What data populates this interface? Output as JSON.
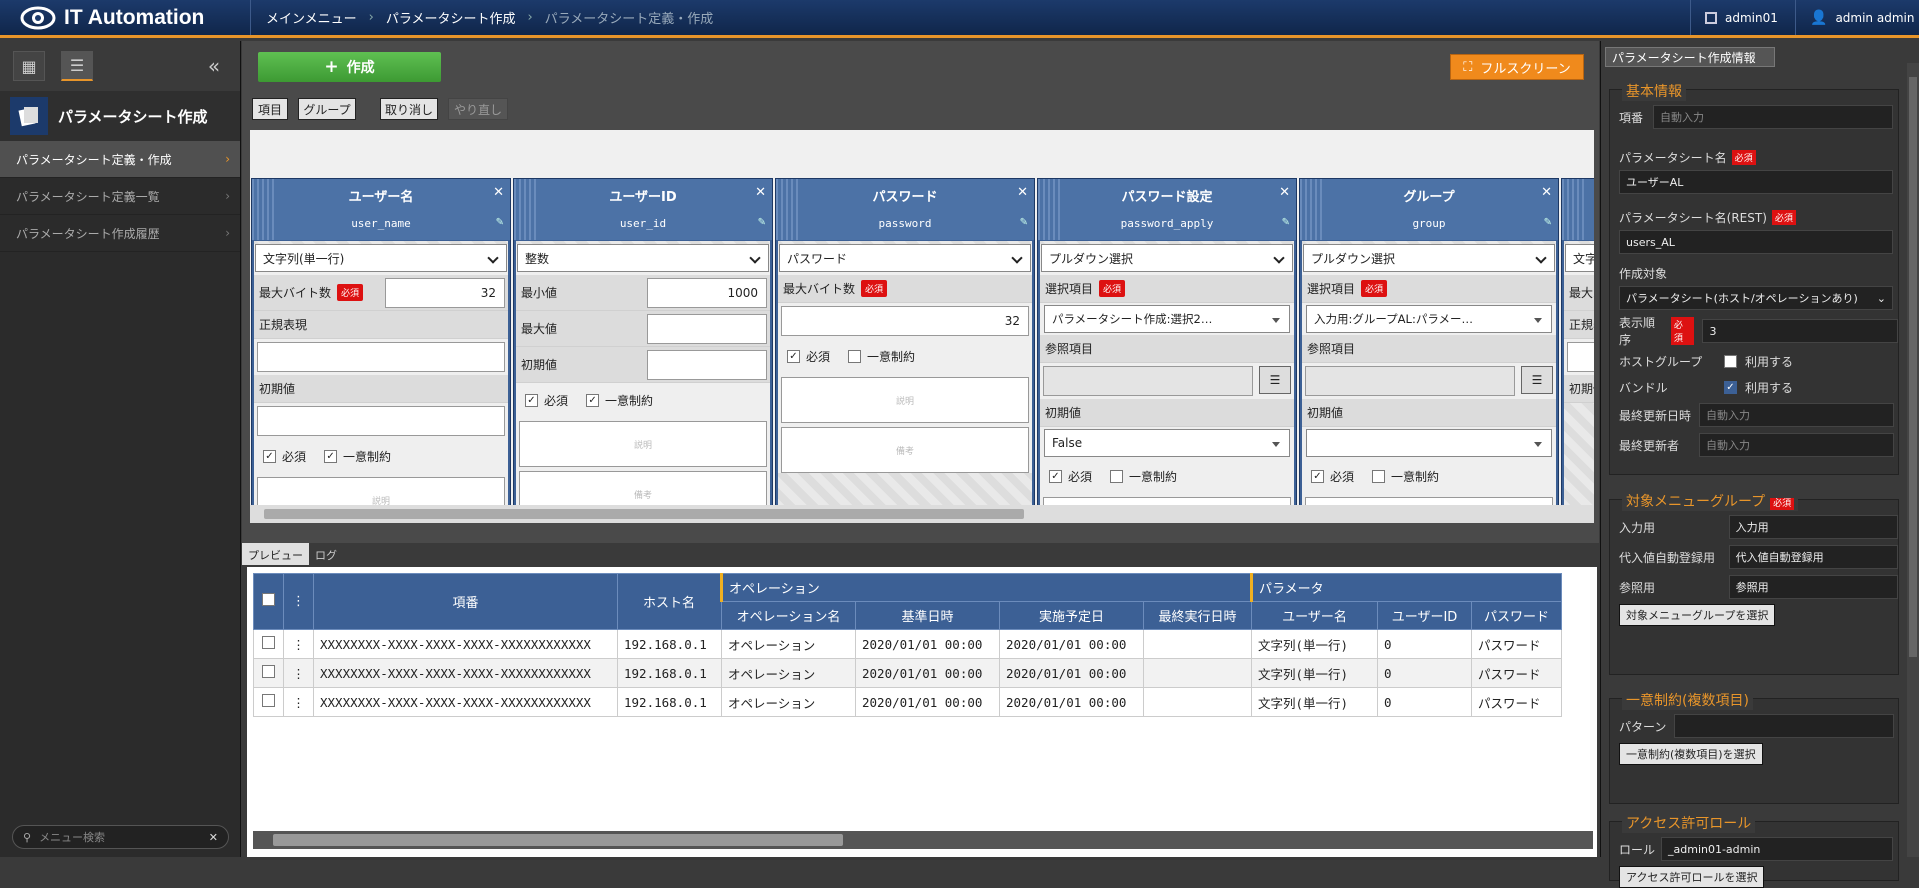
{
  "header": {
    "app_title": "IT Automation",
    "breadcrumbs": [
      "メインメニュー",
      "パラメータシート作成",
      "パラメータシート定義・作成"
    ],
    "workspace": "admin01",
    "user": "admin admin"
  },
  "sidebar": {
    "title": "パラメータシート作成",
    "items": [
      {
        "label": "パラメータシート定義・作成"
      },
      {
        "label": "パラメータシート定義一覧"
      },
      {
        "label": "パラメータシート作成履歴"
      }
    ],
    "search_placeholder": "メニュー検索"
  },
  "toolbar": {
    "create": "作成",
    "fullscreen": "フルスクリーン",
    "item": "項目",
    "group": "グループ",
    "undo": "取り消し",
    "redo": "やり直し"
  },
  "common": {
    "required": "必須",
    "unique": "一意制約",
    "desc": "説明",
    "note": "備考"
  },
  "columns": [
    {
      "name": "ユーザー名",
      "id": "user_name",
      "type": "文字列(単一行)",
      "maxbyte_label": "最大バイト数",
      "maxbyte": "32",
      "regex_label": "正規表現",
      "default_label": "初期値"
    },
    {
      "name": "ユーザーID",
      "id": "user_id",
      "type": "整数",
      "min_label": "最小値",
      "min": "1000",
      "max_label": "最大値",
      "default_label": "初期値"
    },
    {
      "name": "パスワード",
      "id": "password",
      "type": "パスワード",
      "maxbyte_label": "最大バイト数",
      "maxbyte": "32"
    },
    {
      "name": "パスワード設定",
      "id": "password_apply",
      "type": "プルダウン選択",
      "sel_label": "選択項目",
      "sel_value": "パラメータシート作成:選択2…",
      "ref_label": "参照項目",
      "default_label": "初期値",
      "default": "False"
    },
    {
      "name": "グループ",
      "id": "group",
      "type": "プルダウン選択",
      "sel_label": "選択項目",
      "sel_value": "入力用:グループAL:パラメー…",
      "ref_label": "参照項目",
      "default_label": "初期値",
      "default": ""
    }
  ],
  "partial_col": {
    "type": "文字",
    "maxbyte_label": "最大バ",
    "regex_label": "正規表",
    "default_label": "初期値"
  },
  "preview": {
    "tabs": [
      "プレビュー",
      "ログ"
    ],
    "headers": {
      "item_no": "項番",
      "host": "ホスト名",
      "op_group": "オペレーション",
      "op_name": "オペレーション名",
      "base_date": "基準日時",
      "plan_date": "実施予定日",
      "last_run": "最終実行日時",
      "param_group": "パラメータ",
      "user_name": "ユーザー名",
      "user_id": "ユーザーID",
      "password": "パスワード"
    },
    "rows": [
      {
        "item_no": "XXXXXXXX-XXXX-XXXX-XXXX-XXXXXXXXXXXX",
        "host": "192.168.0.1",
        "op_name": "オペレーション",
        "base_date": "2020/01/01 00:00",
        "plan_date": "2020/01/01 00:00",
        "last_run": "",
        "user_name": "文字列(単一行)",
        "user_id": "0",
        "password": "パスワード"
      },
      {
        "item_no": "XXXXXXXX-XXXX-XXXX-XXXX-XXXXXXXXXXXX",
        "host": "192.168.0.1",
        "op_name": "オペレーション",
        "base_date": "2020/01/01 00:00",
        "plan_date": "2020/01/01 00:00",
        "last_run": "",
        "user_name": "文字列(単一行)",
        "user_id": "0",
        "password": "パスワード"
      },
      {
        "item_no": "XXXXXXXX-XXXX-XXXX-XXXX-XXXXXXXXXXXX",
        "host": "192.168.0.1",
        "op_name": "オペレーション",
        "base_date": "2020/01/01 00:00",
        "plan_date": "2020/01/01 00:00",
        "last_run": "",
        "user_name": "文字列(単一行)",
        "user_id": "0",
        "password": "パスワード"
      }
    ]
  },
  "panel": {
    "tab": "パラメータシート作成情報",
    "basic": {
      "legend": "基本情報",
      "item_no_label": "項番",
      "item_no": "自動入力",
      "name_label": "パラメータシート名",
      "name": "ユーザーAL",
      "rest_label": "パラメータシート名(REST)",
      "rest": "users_AL",
      "target_label": "作成対象",
      "target": "パラメータシート(ホスト/オペレーションあり)",
      "order_label": "表示順序",
      "order": "3",
      "hostgroup_label": "ホストグループ",
      "bundle_label": "バンドル",
      "use": "利用する",
      "updated_label": "最終更新日時",
      "updated": "自動入力",
      "updater_label": "最終更新者",
      "updater": "自動入力"
    },
    "menu_group": {
      "legend": "対象メニューグループ",
      "input_label": "入力用",
      "input": "入力用",
      "subst_label": "代入値自動登録用",
      "subst": "代入値自動登録用",
      "ref_label": "参照用",
      "ref": "参照用",
      "button": "対象メニューグループを選択"
    },
    "unique": {
      "legend": "一意制約(複数項目)",
      "pattern_label": "パターン",
      "pattern": "",
      "button": "一意制約(複数項目)を選択"
    },
    "role": {
      "legend": "アクセス許可ロール",
      "role_label": "ロール",
      "role": "_admin01-admin",
      "button": "アクセス許可ロールを選択"
    }
  },
  "colors": {
    "header": "#1c3a6b",
    "accent": "#e8952a",
    "create": "#4caf43",
    "column": "#3c6095",
    "required": "#dd1111"
  }
}
